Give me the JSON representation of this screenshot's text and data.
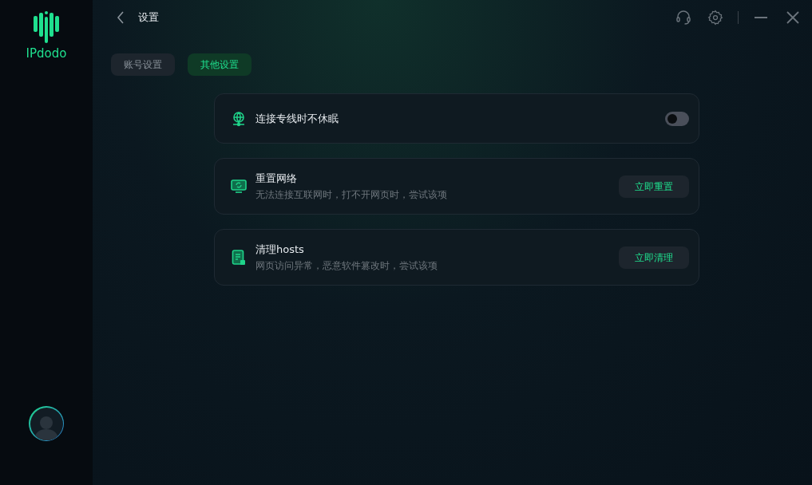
{
  "logo": {
    "name": "IPdodo"
  },
  "header": {
    "title": "设置"
  },
  "tabs": [
    {
      "label": "账号设置",
      "selected": false
    },
    {
      "label": "其他设置",
      "selected": true
    }
  ],
  "settings": [
    {
      "kind": "toggle",
      "title": "连接专线时不休眠",
      "on": false
    },
    {
      "kind": "action",
      "title": "重置网络",
      "description": "无法连接互联网时，打不开网页时，尝试该项",
      "button": "立即重置"
    },
    {
      "kind": "action",
      "title": "清理hosts",
      "description": "网页访问异常，恶意软件篡改时，尝试该项",
      "button": "立即清理"
    }
  ]
}
